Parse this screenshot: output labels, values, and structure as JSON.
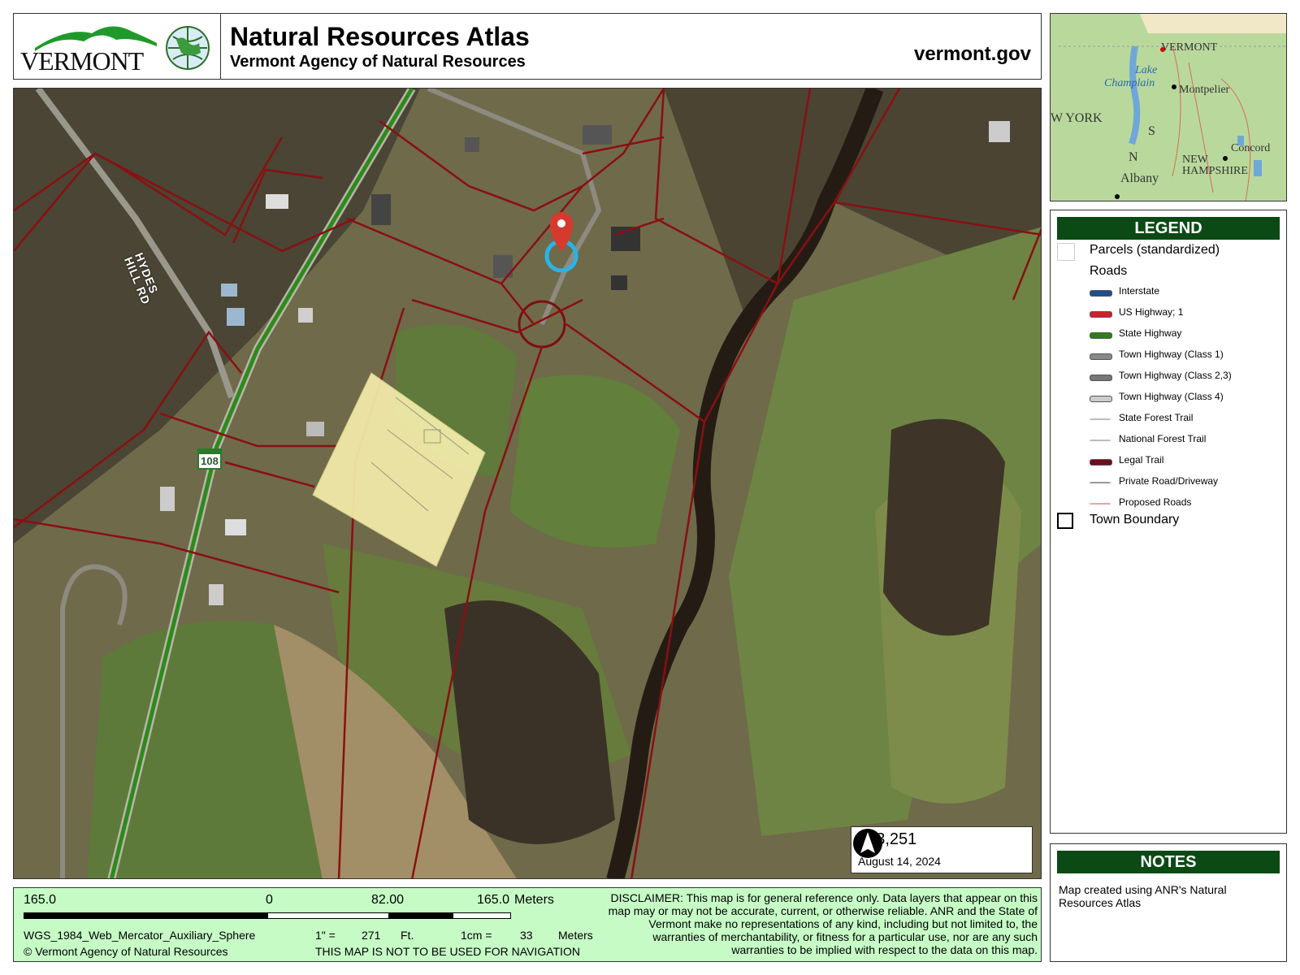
{
  "header": {
    "logo_text": "VERMONT",
    "title": "Natural Resources Atlas",
    "subtitle": "Vermont Agency of Natural Resources",
    "site": "vermont.gov"
  },
  "map": {
    "road_label_line1": "HYDES",
    "road_label_line2": "HILL RD",
    "route_shield": "108",
    "scale_ratio": "1:  3,251",
    "date": "August 14, 2024"
  },
  "inset": {
    "labels": [
      "VERMONT",
      "Lake",
      "Champlain",
      "Montpelier",
      "W YORK",
      "S",
      "N",
      "Albany",
      "NEW",
      "HAMPSHIRE",
      "Concord"
    ]
  },
  "legend": {
    "title": "LEGEND",
    "parcels": "Parcels (standardized)",
    "roads_heading": "Roads",
    "road_items": [
      {
        "label": "Interstate",
        "color": "#1d4f8f"
      },
      {
        "label": "US Highway; 1",
        "color": "#d0202a"
      },
      {
        "label": "State Highway",
        "color": "#2e7d1a"
      },
      {
        "label": "Town Highway (Class 1)",
        "color": "#888888"
      },
      {
        "label": "Town Highway (Class 2,3)",
        "color": "#777777"
      },
      {
        "label": "Town Highway (Class 4)",
        "color": "#cccccc"
      },
      {
        "label": "State Forest Trail",
        "color": "#bbbbbb"
      },
      {
        "label": "National Forest Trail",
        "color": "#bbbbbb"
      },
      {
        "label": "Legal Trail",
        "color": "#6a1020"
      },
      {
        "label": "Private Road/Driveway",
        "color": "#999999"
      },
      {
        "label": "Proposed Roads",
        "color": "#f0a0a0"
      }
    ],
    "town_boundary": "Town Boundary"
  },
  "notes": {
    "title": "NOTES",
    "text": "Map created using ANR's Natural Resources Atlas"
  },
  "footer": {
    "scale_left": "165.0",
    "scale_zero": "0",
    "scale_mid": "82.00",
    "scale_right": "165.0",
    "scale_unit": "Meters",
    "projection": "WGS_1984_Web_Mercator_Auxiliary_Sphere",
    "inch_label": "1\" =",
    "inch_value": "271",
    "inch_unit": "Ft.",
    "cm_label": "1cm =",
    "cm_value": "33",
    "cm_unit": "Meters",
    "copyright": "© Vermont Agency of Natural Resources",
    "nav_warning": "THIS MAP IS NOT TO BE USED FOR NAVIGATION",
    "disclaimer": "DISCLAIMER: This map is for general reference only. Data layers that appear on this map may or may not be accurate, current, or otherwise reliable. ANR and the State of Vermont make no representations of any kind, including but not limited to, the warranties of merchantability, or fitness for a particular use, nor are any such warranties to be implied with respect to the data on this map."
  }
}
